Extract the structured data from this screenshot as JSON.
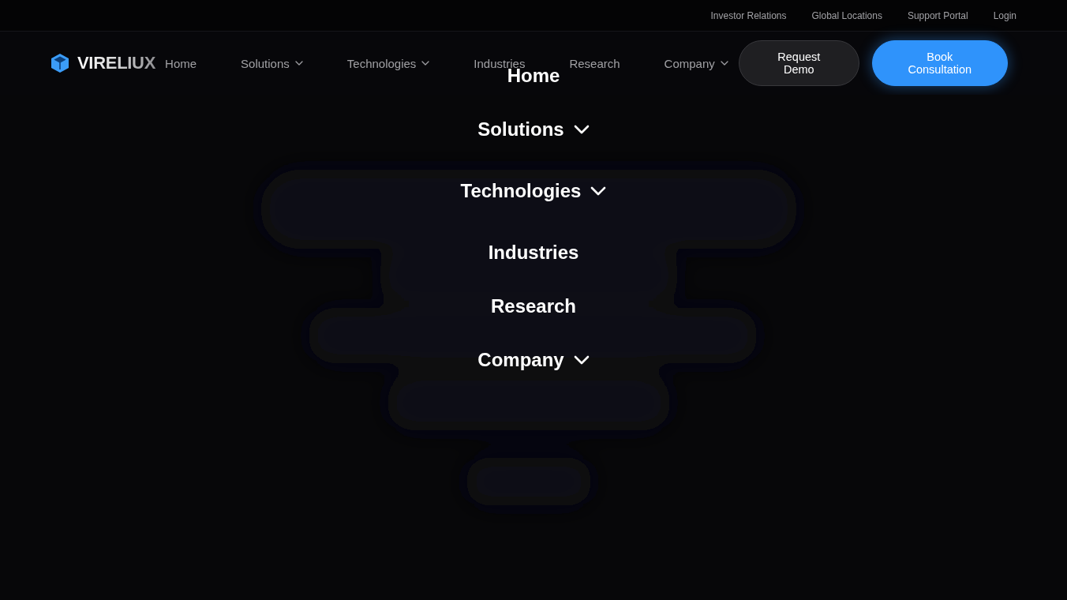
{
  "utility_links": [
    {
      "label": "Investor Relations"
    },
    {
      "label": "Global Locations"
    },
    {
      "label": "Support Portal"
    },
    {
      "label": "Login"
    }
  ],
  "header": {
    "logo": {
      "text": "VIRELIUX"
    },
    "nav": [
      {
        "label": "Home",
        "dropdown": false
      },
      {
        "label": "Solutions",
        "dropdown": true
      },
      {
        "label": "Technologies",
        "dropdown": true
      },
      {
        "label": "Industries",
        "dropdown": false
      },
      {
        "label": "Research",
        "dropdown": false
      },
      {
        "label": "Company",
        "dropdown": true
      }
    ],
    "buttons": [
      {
        "label": "Request Demo",
        "kind": "secondary"
      },
      {
        "label": "Book Consultation",
        "kind": "primary"
      }
    ]
  },
  "mobile_menu": {
    "items": [
      {
        "label": "Home",
        "dropdown": false
      },
      {
        "label": "Solutions",
        "dropdown": true
      },
      {
        "label": "Technologies",
        "dropdown": true
      },
      {
        "label": "Industries",
        "dropdown": false
      },
      {
        "label": "Research",
        "dropdown": false
      },
      {
        "label": "Company",
        "dropdown": true
      }
    ]
  }
}
